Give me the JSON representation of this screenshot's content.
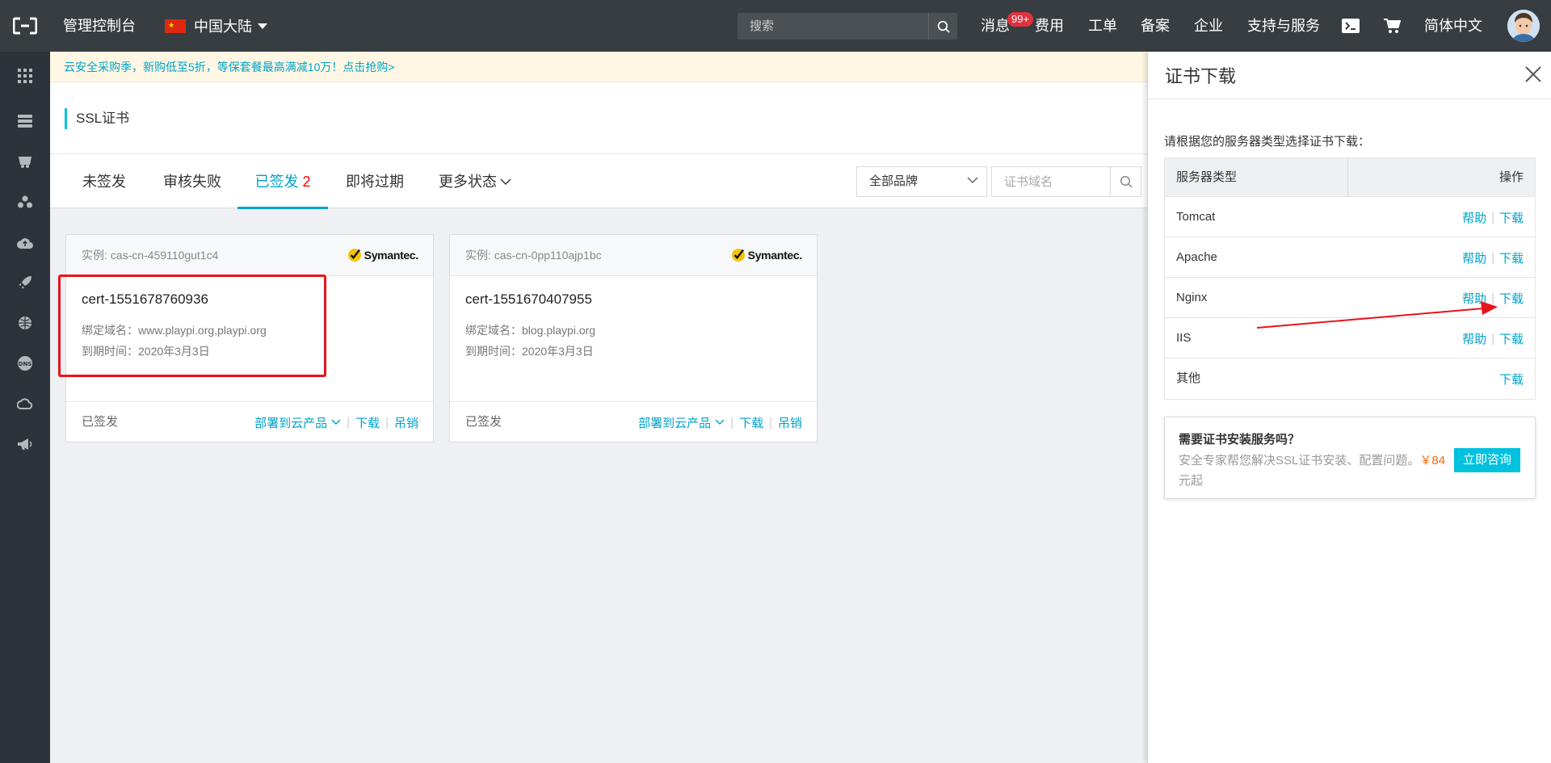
{
  "topbar": {
    "title": "管理控制台",
    "region": "中国大陆",
    "search_placeholder": "搜索",
    "nav": {
      "messages": "消息",
      "messages_badge": "99+",
      "billing": "费用",
      "tickets": "工单",
      "icp": "备案",
      "enterprise": "企业",
      "support": "支持与服务",
      "language": "简体中文"
    },
    "icons": [
      "cloud-console-logo-icon",
      "terminal-icon",
      "cart-icon",
      "search-icon"
    ]
  },
  "sidebar": {
    "icons": [
      "grid-icon",
      "server-icon",
      "database-icon",
      "network-icon",
      "cloud-upload-icon",
      "rocket-icon",
      "globe-icon",
      "dns-icon",
      "cloud-icon",
      "megaphone-icon"
    ]
  },
  "promo": {
    "text": "云安全采购季，新购低至5折，等保套餐最高满减10万！点击抢购>"
  },
  "page": {
    "title": "SSL证书"
  },
  "tabs": [
    {
      "label": "未签发",
      "count": ""
    },
    {
      "label": "审核失败",
      "count": ""
    },
    {
      "label": "已签发",
      "count": "2"
    },
    {
      "label": "即将过期",
      "count": ""
    },
    {
      "label": "更多状态",
      "count": ""
    }
  ],
  "filters": {
    "brand": "全部品牌",
    "domain_placeholder": "证书域名"
  },
  "cards": [
    {
      "instance": "实例: cas-cn-459110gut1c4",
      "brand": "Symantec.",
      "name": "cert-1551678760936",
      "domain": "绑定域名：www.playpi.org,playpi.org",
      "expiry": "到期时间：2020年3月3日",
      "status": "已签发",
      "deploy": "部署到云产品",
      "download": "下载",
      "revoke": "吊销"
    },
    {
      "instance": "实例: cas-cn-0pp110ajp1bc",
      "brand": "Symantec.",
      "name": "cert-1551670407955",
      "domain": "绑定域名：blog.playpi.org",
      "expiry": "到期时间：2020年3月3日",
      "status": "已签发",
      "deploy": "部署到云产品",
      "download": "下载",
      "revoke": "吊销"
    }
  ],
  "drawer": {
    "title": "证书下载",
    "hint": "请根据您的服务器类型选择证书下载：",
    "table": {
      "col_type": "服务器类型",
      "col_ops": "操作",
      "rows": [
        {
          "name": "Tomcat",
          "help": "帮助",
          "download": "下载"
        },
        {
          "name": "Apache",
          "help": "帮助",
          "download": "下载"
        },
        {
          "name": "Nginx",
          "help": "帮助",
          "download": "下载"
        },
        {
          "name": "IIS",
          "help": "帮助",
          "download": "下载"
        },
        {
          "name": "其他",
          "help": "",
          "download": "下载"
        }
      ]
    },
    "service": {
      "question": "需要证书安装服务吗？",
      "desc": "安全专家帮您解决SSL证书安装、配置问题。",
      "price": "￥84",
      "desc2": "元起",
      "button": "立即咨询"
    }
  },
  "colors": {
    "topbar": "#373d41",
    "sidebar": "#2d3339",
    "accent": "#00a2ca",
    "button": "#00c1de",
    "highlight": "#e8131b",
    "price": "#ff6a00"
  }
}
